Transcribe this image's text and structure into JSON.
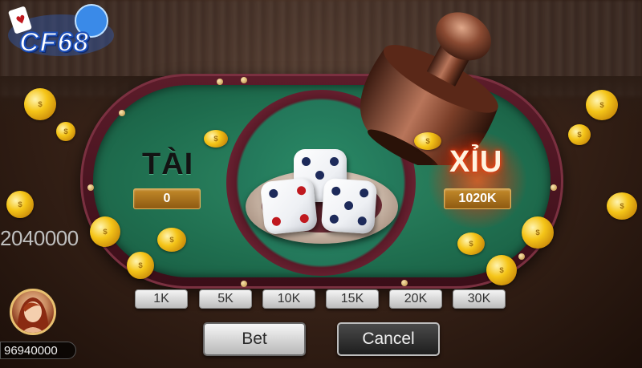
{
  "brand": {
    "logo_text": "CF68"
  },
  "table": {
    "tai": {
      "label": "TÀI",
      "pot": "0"
    },
    "xiu": {
      "label": "XỈU",
      "pot": "1020K"
    }
  },
  "dice": [
    5,
    4,
    5
  ],
  "chips": [
    "1K",
    "5K",
    "10K",
    "15K",
    "20K",
    "30K"
  ],
  "buttons": {
    "bet": "Bet",
    "cancel": "Cancel"
  },
  "player": {
    "pool_total": "2040000",
    "balance": "96940000"
  },
  "colors": {
    "felt": "#1f6e4f",
    "rail": "#5c1c2a",
    "gold": "#c38a2a",
    "xiu_glow": "#ff4a1a"
  },
  "icons": [
    "dice-cup-icon",
    "coin-icon",
    "avatar-icon",
    "logo-icon"
  ]
}
